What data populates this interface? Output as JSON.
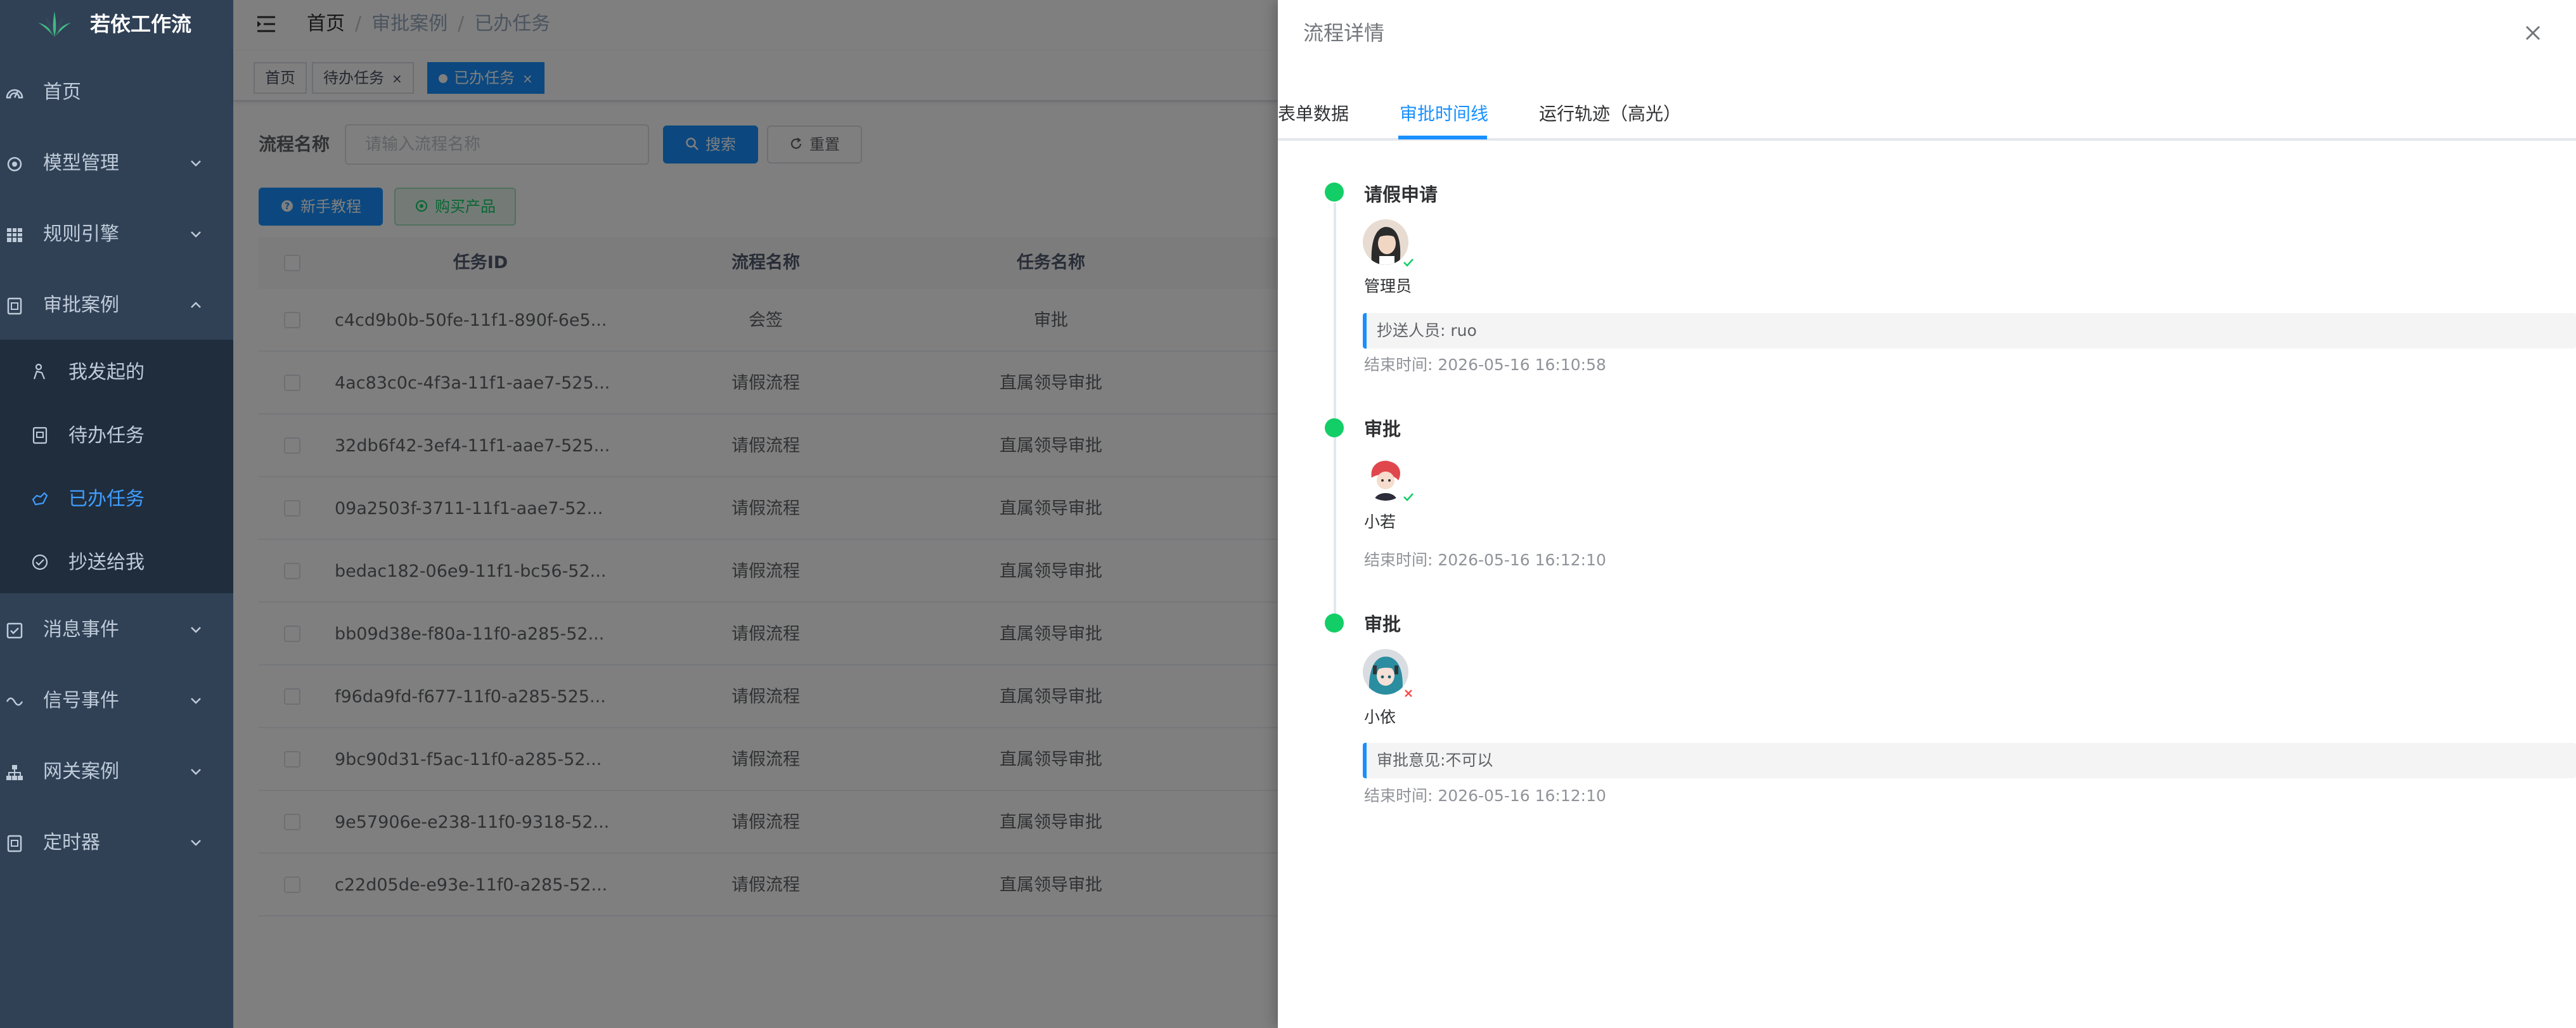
{
  "sidebar": {
    "app_title": "若依工作流",
    "menu": [
      {
        "label": "首页",
        "icon": "dashboard-icon"
      },
      {
        "label": "模型管理",
        "icon": "model-icon"
      },
      {
        "label": "规则引擎",
        "icon": "table-icon"
      },
      {
        "label": "审批案例",
        "icon": "approval-icon"
      },
      {
        "label": "消息事件",
        "icon": "checkbox-icon"
      },
      {
        "label": "信号事件",
        "icon": "signal-icon"
      },
      {
        "label": "网关案例",
        "icon": "tree-icon"
      },
      {
        "label": "定时器",
        "icon": "timer-icon"
      }
    ],
    "submenu": [
      {
        "label": "我发起的",
        "icon": "start-icon"
      },
      {
        "label": "待办任务",
        "icon": "todo-icon"
      },
      {
        "label": "已办任务",
        "icon": "done-icon"
      },
      {
        "label": "抄送给我",
        "icon": "cc-icon"
      }
    ]
  },
  "navbar": {
    "breadcrumb": [
      "首页",
      "审批案例",
      "已办任务"
    ],
    "separator": "/"
  },
  "tags": [
    {
      "label": "首页"
    },
    {
      "label": "待办任务",
      "close": "×"
    },
    {
      "label": "已办任务",
      "close": "×"
    }
  ],
  "search": {
    "label": "流程名称",
    "placeholder": "请输入流程名称",
    "search_button": "搜索",
    "reset_button": "重置",
    "tutorial_button": "新手教程",
    "buy_button": "购买产品"
  },
  "table": {
    "columns": [
      "任务ID",
      "流程名称",
      "任务名称"
    ],
    "rows": [
      {
        "id": "c4cd9b0b-50fe-11f1-890f-6e5...",
        "process": "会签",
        "task": "审批"
      },
      {
        "id": "4ac83c0c-4f3a-11f1-aae7-525...",
        "process": "请假流程",
        "task": "直属领导审批"
      },
      {
        "id": "32db6f42-3ef4-11f1-aae7-525...",
        "process": "请假流程",
        "task": "直属领导审批"
      },
      {
        "id": "09a2503f-3711-11f1-aae7-52...",
        "process": "请假流程",
        "task": "直属领导审批"
      },
      {
        "id": "bedac182-06e9-11f1-bc56-52...",
        "process": "请假流程",
        "task": "直属领导审批"
      },
      {
        "id": "bb09d38e-f80a-11f0-a285-52...",
        "process": "请假流程",
        "task": "直属领导审批"
      },
      {
        "id": "f96da9fd-f677-11f0-a285-525...",
        "process": "请假流程",
        "task": "直属领导审批"
      },
      {
        "id": "9bc90d31-f5ac-11f0-a285-52...",
        "process": "请假流程",
        "task": "直属领导审批"
      },
      {
        "id": "9e57906e-e238-11f0-9318-52...",
        "process": "请假流程",
        "task": "直属领导审批"
      },
      {
        "id": "c22d05de-e93e-11f0-a285-52...",
        "process": "请假流程",
        "task": "直属领导审批"
      }
    ]
  },
  "drawer": {
    "title": "流程详情",
    "tabs": [
      "表单数据",
      "审批时间线",
      "运行轨迹（高光）"
    ],
    "active_tab": "审批时间线",
    "timeline": [
      {
        "title": "请假申请",
        "user": "管理员",
        "status": "approved",
        "note": "抄送人员: ruo",
        "time": "结束时间:  2026-05-16 16:10:58"
      },
      {
        "title": "审批",
        "user": "小若",
        "status": "approved",
        "note": "",
        "time": "结束时间:  2026-05-16 16:12:10"
      },
      {
        "title": "审批",
        "user": "小依",
        "status": "rejected",
        "note": "审批意见:不可以",
        "time": "结束时间:  2026-05-16 16:12:10"
      }
    ]
  },
  "colors": {
    "sidebar_bg": "#304156",
    "submenu_bg": "#1f2d3d",
    "primary": "#1890ff",
    "success": "#13ce66",
    "danger": "#ff4949",
    "mask": "rgba(0,0,0,0.5)"
  }
}
